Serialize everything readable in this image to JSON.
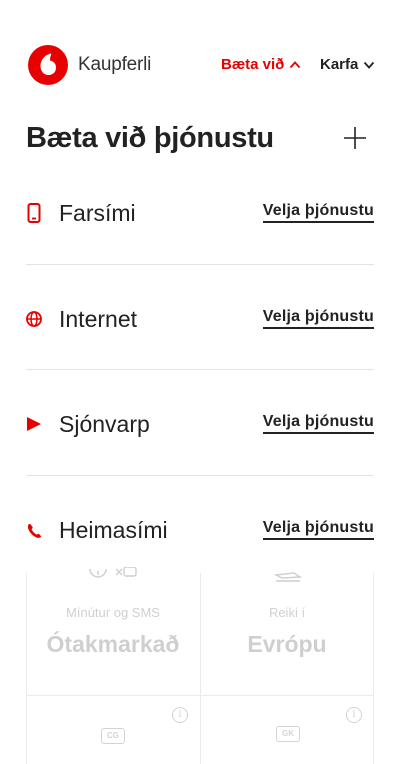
{
  "header": {
    "brand_name": "Kaupferli",
    "add_label": "Bæta við",
    "cart_label": "Karfa",
    "brand_color": "#e60000"
  },
  "page": {
    "title": "Bæta við þjónustu"
  },
  "services": [
    {
      "label": "Farsími",
      "icon": "mobile-phone-icon",
      "link": "Velja þjónustu"
    },
    {
      "label": "Internet",
      "icon": "globe-icon",
      "link": "Velja þjónustu"
    },
    {
      "label": "Sjónvarp",
      "icon": "play-icon",
      "link": "Velja þjónustu"
    },
    {
      "label": "Heimasími",
      "icon": "phone-handset-icon",
      "link": "Velja þjónustu"
    }
  ],
  "background_plan": {
    "cells": [
      {
        "label": "Mínútur og SMS",
        "value": "Ótakmarkað"
      },
      {
        "label": "Reiki í",
        "value": "Evrópu"
      }
    ],
    "sim_badges": [
      "CG",
      "GK"
    ]
  }
}
